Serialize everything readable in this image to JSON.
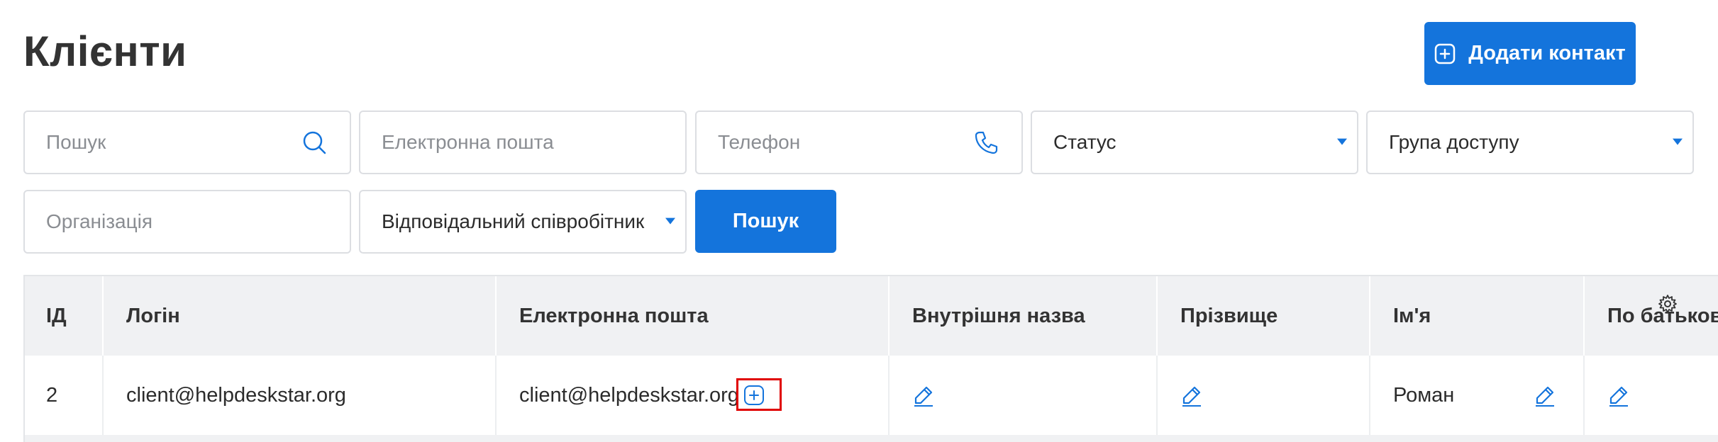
{
  "page": {
    "title": "Клієнти"
  },
  "actions": {
    "add_contact_label": "Додати контакт"
  },
  "filters": {
    "search_placeholder": "Пошук",
    "email_placeholder": "Електронна пошта",
    "phone_placeholder": "Телефон",
    "status_value": "Статус",
    "access_group_value": "Група доступу",
    "organization_placeholder": "Організація",
    "responsible_value": "Відповідальний співробітник",
    "search_button": "Пошук"
  },
  "table": {
    "columns": [
      "ІД",
      "Логін",
      "Електронна пошта",
      "Внутрішня назва",
      "Прізвище",
      "Ім'я",
      "По батькові"
    ],
    "rows": [
      {
        "id": "2",
        "login": "client@helpdeskstar.org",
        "email": "client@helpdeskstar.org",
        "internal_name": "",
        "surname": "",
        "first_name": "Роман",
        "patronymic": ""
      }
    ]
  },
  "colors": {
    "accent": "#1474dc",
    "header_bg": "#f0f1f3",
    "highlight": "#e00000"
  },
  "icons": [
    "plus-square-icon",
    "search-icon",
    "phone-icon",
    "caret-down-icon",
    "edit-pencil-icon",
    "gear-icon",
    "add-email-icon"
  ]
}
